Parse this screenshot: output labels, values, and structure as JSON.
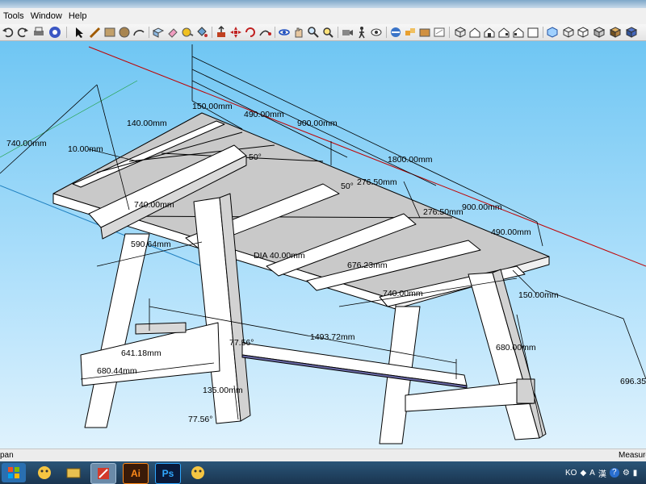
{
  "menu": {
    "items": [
      "Tools",
      "Window",
      "Help"
    ]
  },
  "status": {
    "hint": "pan",
    "measurements_label": "Measuren"
  },
  "tray": {
    "lang": "KO",
    "ime_a": "A",
    "ime_hanja": "漢",
    "help": "?"
  },
  "taskbar": {
    "illustrator": "Ai",
    "photoshop": "Ps"
  },
  "dimensions": {
    "d_150_top": "150.00mm",
    "d_490_top": "490.00mm",
    "d_900_top": "900.00mm",
    "d_140": "140.00mm",
    "d_740_left": "740.00mm",
    "d_10": "10.00mm",
    "d_50_a": "50°",
    "d_1800": "1800.00mm",
    "d_50_b": "50°",
    "d_276_a": "276.50mm",
    "d_740_mid": "740.00mm",
    "d_276_b": "276.50mm",
    "d_900_right": "900.00mm",
    "d_590": "590.64mm",
    "d_490_right": "490.00mm",
    "d_dia": "DIA 40.00mm",
    "d_676": "676.23mm",
    "d_740_low": "740.00mm",
    "d_150_right": "150.00mm",
    "d_77_a": "77.56°",
    "d_1493": "1493.72mm",
    "d_641": "641.18mm",
    "d_680_right": "680.00mm",
    "d_696": "696.35",
    "d_680_left": "680.44mm",
    "d_135": "135.00mm",
    "d_77_b": "77.56°"
  },
  "colors": {
    "sky_top": "#6fc6f3",
    "sky_bottom": "#dff2fd",
    "wood_face": "#ffffff",
    "wood_shade": "#d2d2d2",
    "edge": "#000000",
    "axis_red": "#c00000"
  }
}
